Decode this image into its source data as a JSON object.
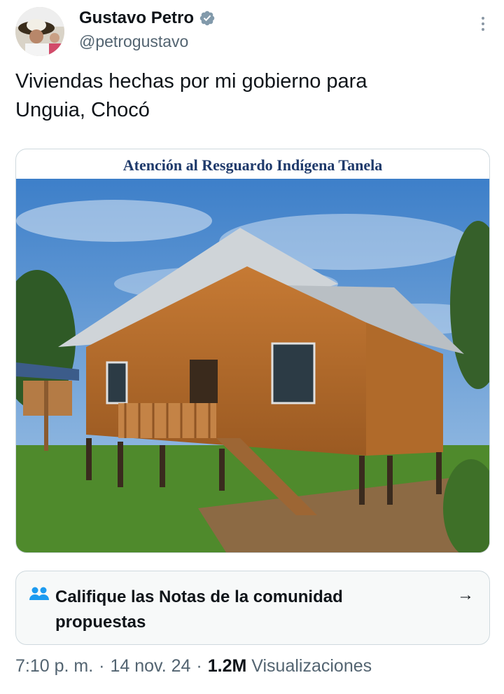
{
  "author": {
    "display_name": "Gustavo Petro",
    "handle": "@petrogustavo",
    "verified_color": "#829aab"
  },
  "tweet": {
    "text": "Viviendas hechas por mi gobierno para\nUnguia, Chocó"
  },
  "media": {
    "caption": "Atención al Resguardo Indígena Tanela"
  },
  "community_notes": {
    "label": "Califique las Notas de la comunidad propuestas",
    "icon": "people-icon",
    "arrow": "→",
    "accent": "#1d9bf0"
  },
  "meta": {
    "time": "7:10 p. m.",
    "separator": "·",
    "date": "14 nov. 24",
    "views_count": "1.2M",
    "views_label": "Visualizaciones"
  }
}
